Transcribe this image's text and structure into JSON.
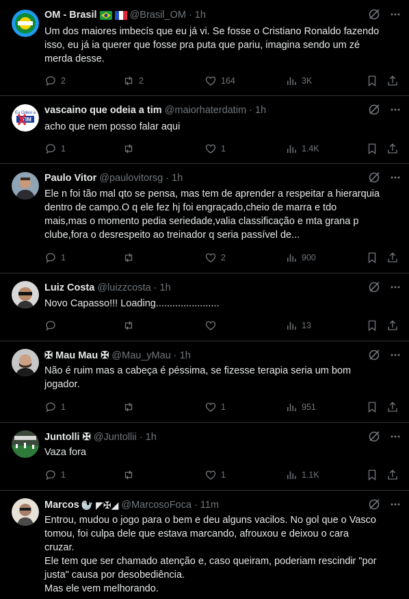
{
  "tweets": [
    {
      "name": "OM - Brasil",
      "handle": "@Brasil_OM",
      "time": "1h",
      "text": "Um dos maiores imbecís que eu já vi. Se fosse o Cristiano Ronaldo fazendo\nisso, eu já ia querer que fosse pra puta que pariu, imagina sendo um zé\nmerda desse.",
      "replies": "2",
      "reposts": "2",
      "likes": "164",
      "views": "3K"
    },
    {
      "name": "vascaino que odeia a tim",
      "handle": "@maiorhaterdatim",
      "time": "1h",
      "avatar_text": "Eu Odeio a TIM",
      "text": "acho que nem posso falar aqui",
      "replies": "1",
      "reposts": "",
      "likes": "1",
      "views": "1.4K"
    },
    {
      "name": "Paulo Vitor",
      "handle": "@paulovitorsg",
      "time": "1h",
      "text": "Ele n foi tão mal qto se pensa, mas tem de aprender a respeitar a hierarquia\ndentro de campo.O q ele fez hj foi engraçado,cheio de marra e tdo\nmais,mas o momento pedia seriedade,valia classificação e mta grana p\nclube,fora o desrespeito ao treinador q seria passível de...",
      "replies": "1",
      "reposts": "",
      "likes": "2",
      "views": "900"
    },
    {
      "name": "Luiz Costa",
      "handle": "@luizzcosta",
      "time": "1h",
      "text": "Novo Capasso!!! Loading.......................",
      "replies": "",
      "reposts": "",
      "likes": "",
      "views": "13"
    },
    {
      "name": "✠ Mau Mau ✠",
      "handle": "@Mau_yMau",
      "time": "1h",
      "text": "Não é ruim mas a cabeça é péssima, se fizesse terapia seria um bom\njogador.",
      "replies": "1",
      "reposts": "",
      "likes": "1",
      "views": "951"
    },
    {
      "name": "Juntolli ✠",
      "handle": "@Juntollii",
      "time": "1h",
      "text": "Vaza fora",
      "replies": "1",
      "reposts": "",
      "likes": "1",
      "views": "1.1K"
    },
    {
      "name": "Marcos",
      "name_emoji": "🦭 ◤✠◢",
      "handle": "@MarcosoFoca",
      "time": "11m",
      "text": "Entrou, mudou o jogo para o bem e deu alguns vacilos. No gol que o Vasco\ntomou, foi culpa dele que estava marcando, afrouxou e deixou o cara\ncruzar.\nEle tem que ser chamado atenção e, caso queiram, poderiam rescindir \"por\njusta\" causa por desobediência.\nMas ele vem melhorando.",
      "replies": "",
      "reposts": "",
      "likes": "",
      "views": ""
    }
  ],
  "colors": {
    "bg": "#000000",
    "text": "#e7e9ea",
    "muted": "#71767b",
    "border": "#2f3336"
  }
}
